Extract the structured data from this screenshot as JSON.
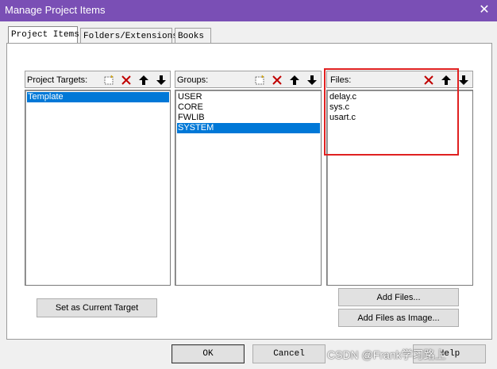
{
  "window": {
    "title": "Manage Project Items",
    "close_glyph": "✕"
  },
  "tabs": [
    {
      "label": "Project Items",
      "active": true
    },
    {
      "label": "Folders/Extensions",
      "active": false
    },
    {
      "label": "Books",
      "active": false
    }
  ],
  "targets_panel": {
    "label": "Project Targets:",
    "icons": [
      "new-item-icon",
      "delete-icon",
      "move-up-icon",
      "move-down-icon"
    ],
    "items": [
      {
        "text": "Template",
        "selected": true
      }
    ]
  },
  "groups_panel": {
    "label": "Groups:",
    "icons": [
      "new-item-icon",
      "delete-icon",
      "move-up-icon",
      "move-down-icon"
    ],
    "items": [
      {
        "text": "USER",
        "selected": false
      },
      {
        "text": "CORE",
        "selected": false
      },
      {
        "text": "FWLIB",
        "selected": false
      },
      {
        "text": "SYSTEM",
        "selected": true
      }
    ]
  },
  "files_panel": {
    "label": "Files:",
    "icons": [
      "delete-icon",
      "move-up-icon",
      "move-down-icon"
    ],
    "items": [
      {
        "text": "delay.c"
      },
      {
        "text": "sys.c"
      },
      {
        "text": "usart.c"
      }
    ]
  },
  "buttons": {
    "set_current_target": "Set as Current Target",
    "add_files": "Add Files...",
    "add_files_as_image": "Add Files as Image...",
    "ok": "OK",
    "cancel": "Cancel",
    "help": "Help"
  },
  "watermark": "CSDN @Frank学习路上",
  "colors": {
    "title_bar": "#7a4fb5",
    "selection": "#0078d7",
    "highlight_box": "#e02020",
    "delete_icon": "#c00000"
  }
}
